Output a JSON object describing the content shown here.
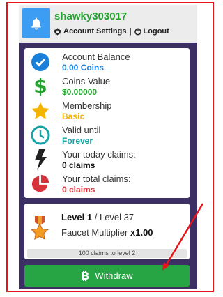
{
  "header": {
    "username": "shawky303017",
    "account_settings": "Account Settings",
    "separator": "|",
    "logout": "Logout"
  },
  "stats": [
    {
      "label": "Account Balance",
      "value": "0.00 Coins",
      "color": "#1a7fd8",
      "icon": "check-circle-icon"
    },
    {
      "label": "Coins Value",
      "value": "$0.00000",
      "color": "#23a02e",
      "icon": "dollar-icon"
    },
    {
      "label": "Membership",
      "value": "Basic",
      "color": "#f5b400",
      "icon": "star-icon"
    },
    {
      "label": "Valid until",
      "value": "Forever",
      "color": "#18a2a8",
      "icon": "clock-icon"
    },
    {
      "label": "Your today claims:",
      "value": "0 claims",
      "color": "#111111",
      "icon": "bolt-icon"
    },
    {
      "label": "Your total claims:",
      "value": "0 claims",
      "color": "#d9323a",
      "icon": "pie-chart-icon"
    }
  ],
  "level": {
    "current": "Level 1",
    "separator": "/",
    "next": "Level 37",
    "multiplier_label": "Faucet Multiplier",
    "multiplier_value": "x1.00",
    "progress_text": "100 claims to level 2",
    "progress_fraction": 0
  },
  "withdraw": {
    "label": "Withdraw",
    "icon": "bitcoin-icon"
  },
  "colors": {
    "frame": "#e8141b",
    "panel": "#3c2f63",
    "accent_blue": "#3d9df3",
    "button_green": "#27a444"
  }
}
